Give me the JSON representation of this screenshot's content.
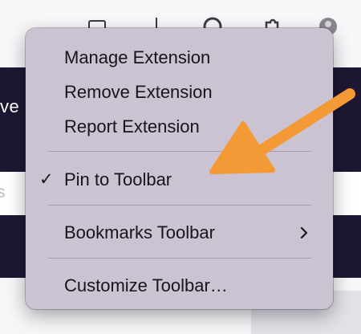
{
  "page": {
    "background_partial_text_left": "ve",
    "background_partial_text_field": "s"
  },
  "context_menu": {
    "items": [
      {
        "label": "Manage Extension",
        "checked": false,
        "has_submenu": false
      },
      {
        "label": "Remove Extension",
        "checked": false,
        "has_submenu": false
      },
      {
        "label": "Report Extension",
        "checked": false,
        "has_submenu": false
      },
      {
        "label": "Pin to Toolbar",
        "checked": true,
        "has_submenu": false,
        "check_glyph": "✓"
      },
      {
        "label": "Bookmarks Toolbar",
        "checked": false,
        "has_submenu": true,
        "submenu_icon": "chevron-right-icon"
      },
      {
        "label": "Customize Toolbar…",
        "checked": false,
        "has_submenu": false
      }
    ]
  },
  "annotation": {
    "arrow_color": "#F39A37",
    "arrow_target": "Pin to Toolbar"
  },
  "toolbar_icons": [
    "toolbar-icon",
    "toolbar-icon",
    "account-icon",
    "extensions-puzzle-icon",
    "profile-avatar-icon"
  ],
  "colors": {
    "menu_background": "#CBC2D2",
    "dark_band": "#1E1733",
    "arrow": "#F39A37"
  }
}
